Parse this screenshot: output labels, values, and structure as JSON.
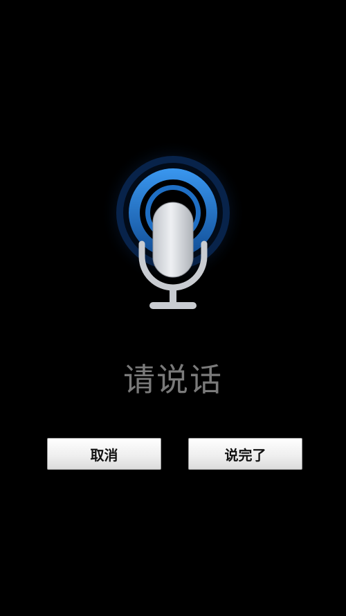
{
  "voice_dialog": {
    "prompt": "请说话",
    "cancel_label": "取消",
    "done_label": "说完了"
  },
  "icons": {
    "microphone": "microphone-icon"
  },
  "colors": {
    "background": "#000000",
    "accent_blue": "#2a7fd6",
    "mic_body": "#d8dbe0",
    "prompt_text": "#7a7a7a"
  }
}
